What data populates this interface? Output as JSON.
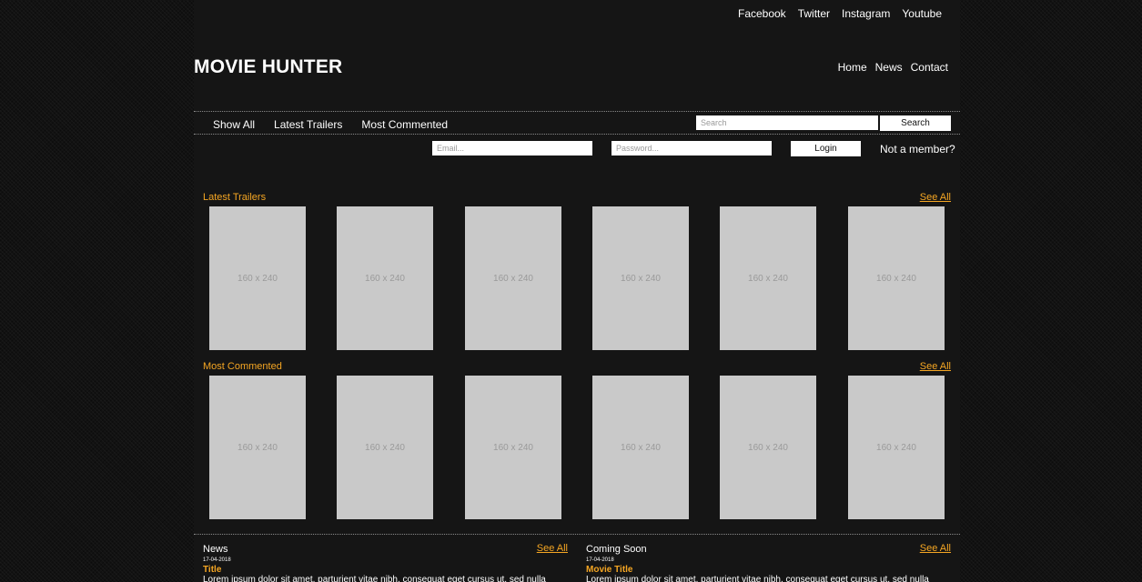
{
  "social": [
    "Facebook",
    "Twitter",
    "Instagram",
    "Youtube"
  ],
  "logo": "MOVIE HUNTER",
  "main_nav": [
    "Home",
    "News",
    "Contact"
  ],
  "sub_nav": [
    "Show All",
    "Latest Trailers",
    "Most Commented"
  ],
  "search": {
    "placeholder": "Search",
    "button": "Search"
  },
  "login": {
    "email_placeholder": "Email...",
    "password_placeholder": "Password...",
    "button": "Login",
    "not_member": "Not a member?"
  },
  "colors": {
    "accent": "#f5a623",
    "poster": "#c9c9c9",
    "background": "#151515"
  },
  "latest_trailers": {
    "title": "Latest Trailers",
    "see_all": "See All",
    "posters": [
      "160 x 240",
      "160 x 240",
      "160 x 240",
      "160 x 240",
      "160 x 240",
      "160 x 240"
    ]
  },
  "most_commented": {
    "title": "Most Commented",
    "see_all": "See All",
    "posters": [
      "160 x 240",
      "160 x 240",
      "160 x 240",
      "160 x 240",
      "160 x 240",
      "160 x 240"
    ]
  },
  "news": {
    "title": "News",
    "see_all": "See All",
    "date": "17-04-2018",
    "item_title": "Title",
    "excerpt": "Lorem ipsum dolor sit amet, parturient vitae nibh, consequat eget cursus ut, sed nulla"
  },
  "coming_soon": {
    "title": "Coming Soon",
    "see_all": "See All",
    "date": "17-04-2018",
    "item_title": "Movie Title",
    "excerpt": "Lorem ipsum dolor sit amet, parturient vitae nibh, consequat eget cursus ut, sed nulla"
  }
}
